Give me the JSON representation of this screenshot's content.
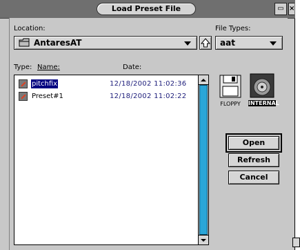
{
  "window": {
    "title": "Load Preset File"
  },
  "location": {
    "label": "Location:",
    "value": "AntaresAT"
  },
  "file_types": {
    "label": "File Types:",
    "value": "aat"
  },
  "list_header": {
    "type": "Type:",
    "name": "Name:",
    "date": "Date:"
  },
  "files": [
    {
      "name": "pitchfix",
      "date": "12/18/2002  11:02:36",
      "selected": true
    },
    {
      "name": "Preset#1",
      "date": "12/18/2002  11:02:22",
      "selected": false
    }
  ],
  "volumes": [
    {
      "label": "FLOPPY"
    },
    {
      "label": "INTERNAL"
    }
  ],
  "buttons": {
    "open": "Open",
    "refresh": "Refresh",
    "cancel": "Cancel"
  },
  "colors": {
    "selection": "#000080",
    "scroll_track": "#2aa6d8",
    "date_text": "#1c1c7a"
  }
}
